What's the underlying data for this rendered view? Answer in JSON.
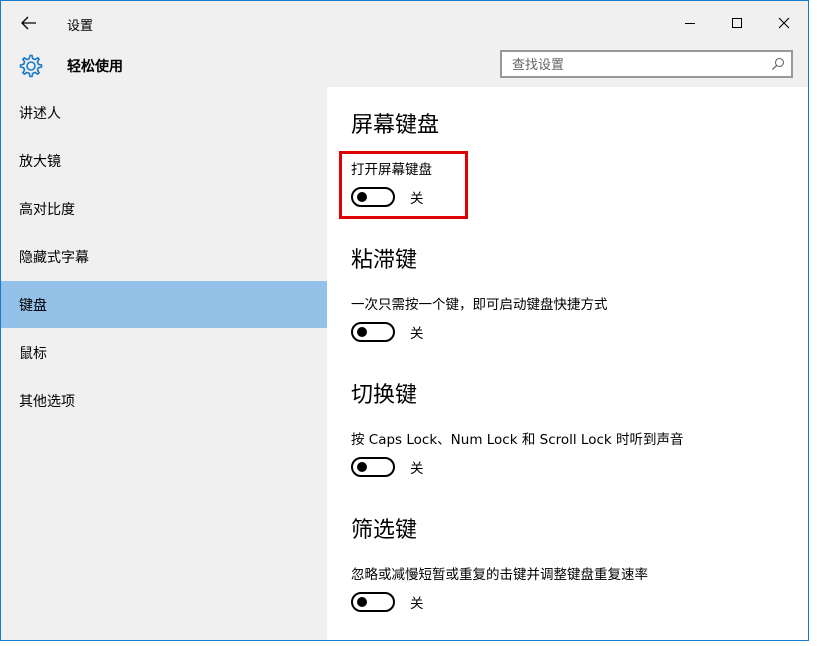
{
  "window": {
    "title": "设置"
  },
  "header": {
    "section_name": "轻松使用",
    "search_placeholder": "查找设置"
  },
  "sidebar": {
    "items": [
      {
        "label": "讲述人",
        "selected": false
      },
      {
        "label": "放大镜",
        "selected": false
      },
      {
        "label": "高对比度",
        "selected": false
      },
      {
        "label": "隐藏式字幕",
        "selected": false
      },
      {
        "label": "键盘",
        "selected": true
      },
      {
        "label": "鼠标",
        "selected": false
      },
      {
        "label": "其他选项",
        "selected": false
      }
    ]
  },
  "content": {
    "sections": [
      {
        "heading": "屏幕键盘",
        "description": "打开屏幕键盘",
        "toggle_state": "关",
        "on": false
      },
      {
        "heading": "粘滞键",
        "description": "一次只需按一个键，即可启动键盘快捷方式",
        "toggle_state": "关",
        "on": false
      },
      {
        "heading": "切换键",
        "description": "按 Caps Lock、Num Lock 和 Scroll Lock 时听到声音",
        "toggle_state": "关",
        "on": false
      },
      {
        "heading": "筛选键",
        "description": "忽略或减慢短暂或重复的击键并调整键盘重复速率",
        "toggle_state": "关",
        "on": false
      }
    ]
  },
  "colors": {
    "window_border": "#1979ca",
    "selected_item": "#93c1e8",
    "highlight": "#e00000",
    "chrome_bg": "#f0f0f0"
  },
  "icons": {
    "back": "back-arrow-icon",
    "gear": "gear-icon",
    "search": "search-icon",
    "minimize": "minimize-icon",
    "maximize": "maximize-icon",
    "close": "close-icon"
  }
}
